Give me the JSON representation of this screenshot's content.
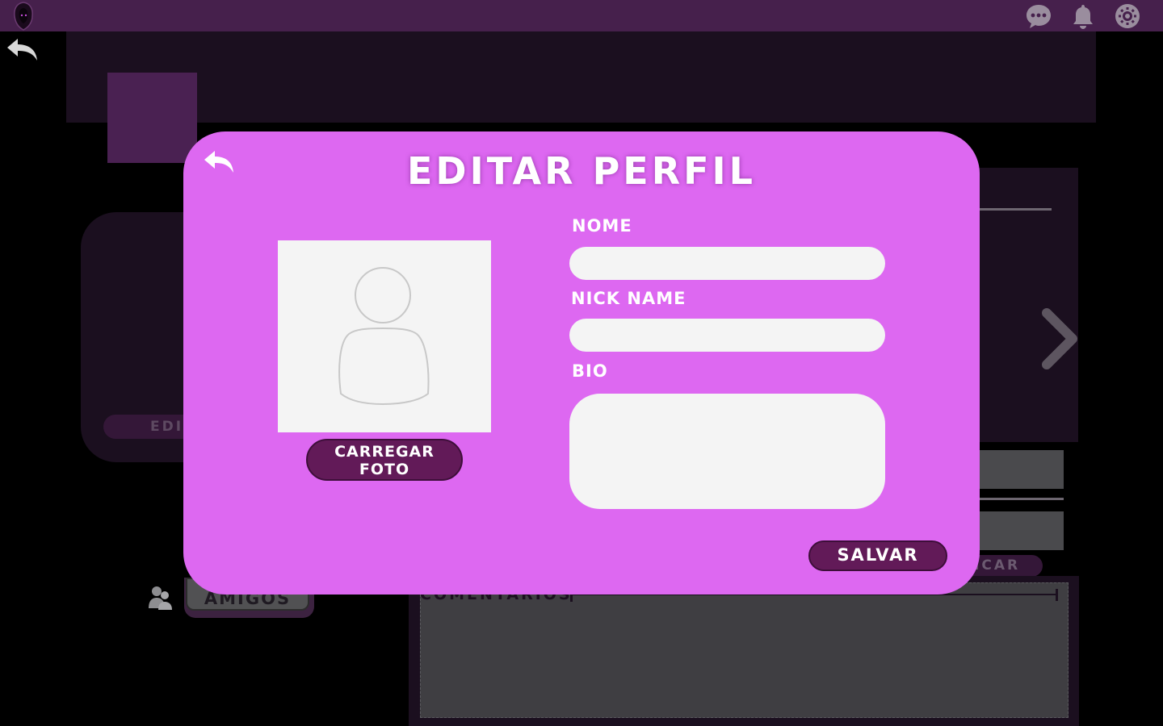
{
  "topbar": {
    "logo_icon": "hooded-figure-logo",
    "icons": [
      "chat-icon",
      "bell-icon",
      "gear-icon"
    ]
  },
  "background": {
    "edit_button_label": "EDI",
    "publish_button_label": "PUBLICAR",
    "comments_title": "COMENTÁRIOS",
    "friends_button_label": "AMIGOS"
  },
  "modal": {
    "title": "EDITAR PERFIL",
    "upload_button_label": "CARREGAR FOTO",
    "fields": {
      "nome_label": "NOME",
      "nome_value": "",
      "nick_label": "NICK NAME",
      "nick_value": "",
      "bio_label": "BIO",
      "bio_value": ""
    },
    "save_button_label": "SALVAR"
  },
  "colors": {
    "topbar": "#46204c",
    "modal_bg": "#dd68f1",
    "button_bg": "#621a58",
    "input_bg": "#f4f4f4"
  }
}
